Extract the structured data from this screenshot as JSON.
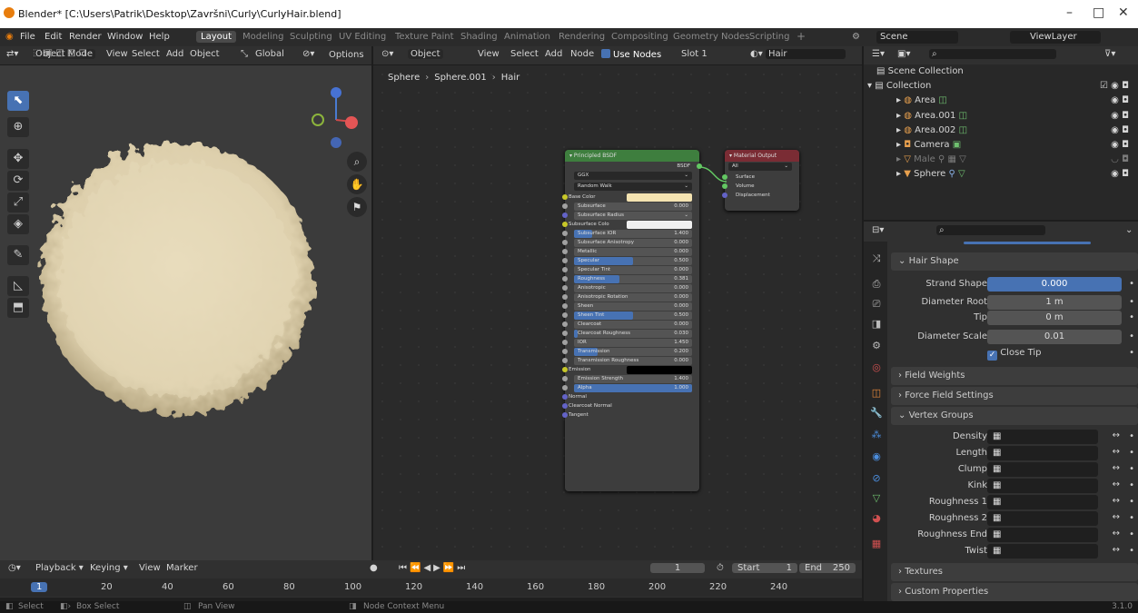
{
  "window": {
    "title": "Blender* [C:\\Users\\Patrik\\Desktop\\Završni\\Curly\\CurlyHair.blend]",
    "min": "–",
    "max": "□",
    "close": "✕"
  },
  "menu": [
    "File",
    "Edit",
    "Render",
    "Window",
    "Help"
  ],
  "workspaces": [
    "Layout",
    "Modeling",
    "Sculpting",
    "UV Editing",
    "Texture Paint",
    "Shading",
    "Animation",
    "Rendering",
    "Compositing",
    "Geometry Nodes",
    "Scripting",
    "+"
  ],
  "scene": {
    "label": "Scene",
    "view_layer": "ViewLayer"
  },
  "viewport": {
    "mode": "Object Mode",
    "view": "View",
    "select": "Select",
    "add": "Add",
    "object": "Object",
    "transform": "Global",
    "options": "Options"
  },
  "node_editor": {
    "type": "Object",
    "view": "View",
    "select": "Select",
    "add": "Add",
    "node": "Node",
    "use_nodes": "Use Nodes",
    "slot": "Slot 1",
    "material": "Hair",
    "bc_object": "Sphere",
    "bc_mesh": "Sphere.001",
    "bc_material": "Hair"
  },
  "bsdf": {
    "title": "Principled BSDF",
    "out": "BSDF",
    "dist": "GGX",
    "sss_method": "Random Walk",
    "inputs": [
      {
        "label": "Base Color",
        "type": "color",
        "color": "#f4e3b1",
        "sock": "#c7c729"
      },
      {
        "label": "Subsurface",
        "value": "0.000",
        "fill": 0,
        "sock": "#a1a1a1"
      },
      {
        "label": "Subsurface Radius",
        "type": "dropdown",
        "sock": "#6363c7"
      },
      {
        "label": "Subsurface Colo",
        "type": "color",
        "color": "#f0f0f0",
        "sock": "#c7c729"
      },
      {
        "label": "Subsurface IOR",
        "value": "1.400",
        "fill": 0.15,
        "sock": "#a1a1a1"
      },
      {
        "label": "Subsurface Anisotropy",
        "value": "0.000",
        "fill": 0,
        "sock": "#a1a1a1"
      },
      {
        "label": "Metallic",
        "value": "0.000",
        "fill": 0,
        "sock": "#a1a1a1"
      },
      {
        "label": "Specular",
        "value": "0.500",
        "fill": 0.5,
        "sock": "#a1a1a1"
      },
      {
        "label": "Specular Tint",
        "value": "0.000",
        "fill": 0,
        "sock": "#a1a1a1"
      },
      {
        "label": "Roughness",
        "value": "0.381",
        "fill": 0.381,
        "sock": "#a1a1a1"
      },
      {
        "label": "Anisotropic",
        "value": "0.000",
        "fill": 0,
        "sock": "#a1a1a1"
      },
      {
        "label": "Anisotropic Rotation",
        "value": "0.000",
        "fill": 0,
        "sock": "#a1a1a1"
      },
      {
        "label": "Sheen",
        "value": "0.000",
        "fill": 0,
        "sock": "#a1a1a1"
      },
      {
        "label": "Sheen Tint",
        "value": "0.500",
        "fill": 0.5,
        "sock": "#a1a1a1"
      },
      {
        "label": "Clearcoat",
        "value": "0.000",
        "fill": 0,
        "sock": "#a1a1a1"
      },
      {
        "label": "Clearcoat Roughness",
        "value": "0.030",
        "fill": 0.03,
        "sock": "#a1a1a1"
      },
      {
        "label": "IOR",
        "value": "1.450",
        "fill": 0,
        "sock": "#a1a1a1"
      },
      {
        "label": "Transmission",
        "value": "0.200",
        "fill": 0.2,
        "sock": "#a1a1a1"
      },
      {
        "label": "Transmission Roughness",
        "value": "0.000",
        "fill": 0,
        "sock": "#a1a1a1"
      },
      {
        "label": "Emission",
        "type": "color",
        "color": "#000000",
        "sock": "#c7c729"
      },
      {
        "label": "Emission Strength",
        "value": "1.400",
        "fill": 0,
        "sock": "#a1a1a1"
      },
      {
        "label": "Alpha",
        "value": "1.000",
        "fill": 1,
        "sock": "#a1a1a1"
      },
      {
        "label": "Normal",
        "type": "plain",
        "sock": "#6363c7"
      },
      {
        "label": "Clearcoat Normal",
        "type": "plain",
        "sock": "#6363c7"
      },
      {
        "label": "Tangent",
        "type": "plain",
        "sock": "#6363c7"
      }
    ]
  },
  "matout": {
    "title": "Material Output",
    "target": "All",
    "inputs": [
      "Surface",
      "Volume",
      "Displacement"
    ]
  },
  "outliner": {
    "root": "Scene Collection",
    "collection": "Collection",
    "items": [
      "Area",
      "Area.001",
      "Area.002",
      "Camera",
      "Male",
      "Sphere"
    ]
  },
  "props": {
    "hair_shape": "Hair Shape",
    "strand_shape": {
      "label": "Strand Shape",
      "value": "0.000"
    },
    "diameter_root": {
      "label": "Diameter Root",
      "value": "1 m"
    },
    "tip": {
      "label": "Tip",
      "value": "0 m"
    },
    "diameter_scale": {
      "label": "Diameter Scale",
      "value": "0.01"
    },
    "close_tip": "Close Tip",
    "field_weights": "Field Weights",
    "force_field": "Force Field Settings",
    "vertex_groups": "Vertex Groups",
    "vgroups": [
      "Density",
      "Length",
      "Clump",
      "Kink",
      "Roughness 1",
      "Roughness 2",
      "Roughness End",
      "Twist"
    ],
    "textures": "Textures",
    "custom": "Custom Properties"
  },
  "timeline": {
    "playback": "Playback",
    "keying": "Keying",
    "view": "View",
    "marker": "Marker",
    "frame": "1",
    "start_label": "Start",
    "start": "1",
    "end_label": "End",
    "end": "250",
    "ticks": [
      "1",
      "20",
      "40",
      "60",
      "80",
      "100",
      "120",
      "140",
      "160",
      "180",
      "200",
      "220",
      "240"
    ]
  },
  "status": {
    "select": "Select",
    "box": "Box Select",
    "pan": "Pan View",
    "ctx": "Node Context Menu",
    "version": "3.1.0"
  }
}
